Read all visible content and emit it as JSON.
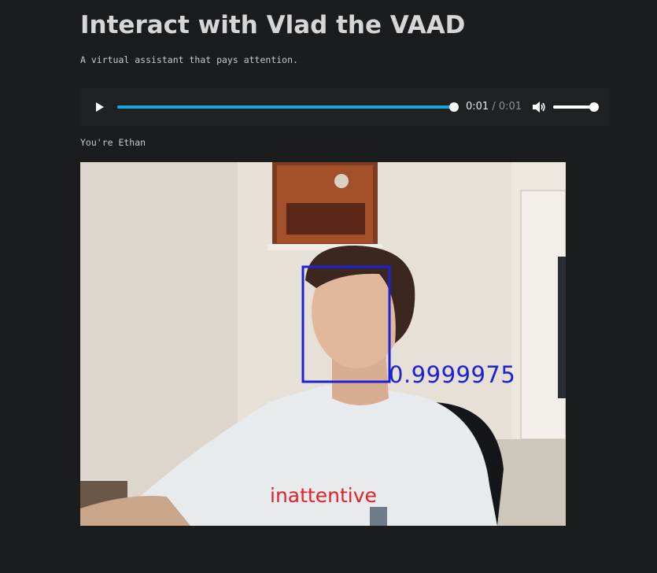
{
  "header": {
    "title": "Interact with Vlad the VAAD",
    "subtitle": "A virtual assistant that pays attention."
  },
  "audio_player": {
    "current_time": "0:01",
    "separator": "/",
    "duration": "0:01",
    "progress": 1.0,
    "volume": 1.0,
    "accent_color": "#17a7dc"
  },
  "user_label": "You're Ethan",
  "video_feed": {
    "attention_score": "0.9999975",
    "attention_state": "inattentive",
    "box_color": "#1d22d6",
    "state_color": "#e61e2a"
  }
}
